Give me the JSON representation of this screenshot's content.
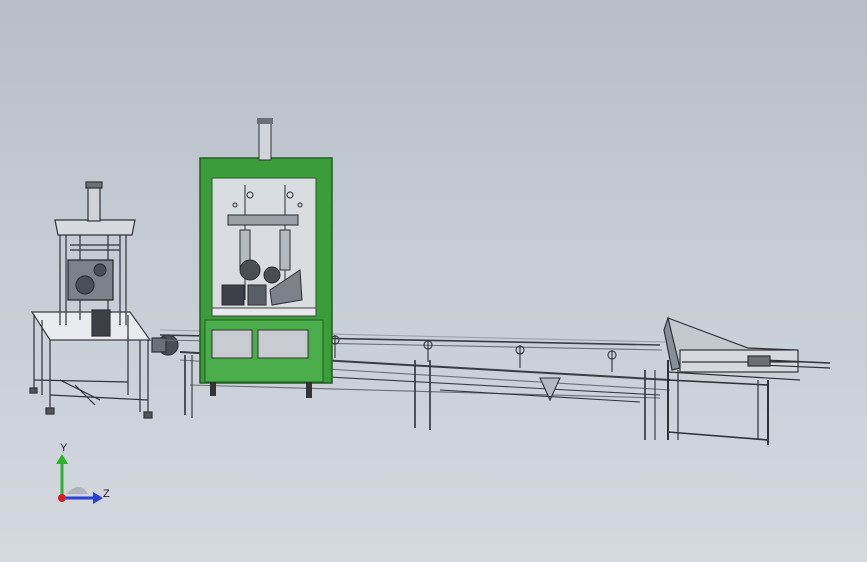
{
  "triad": {
    "y_label": "Y",
    "z_label": "Z",
    "colors": {
      "y_axis": "#2bb32b",
      "z_axis": "#2a3fd6",
      "x_axis": "#d42020"
    }
  },
  "scene": {
    "colors": {
      "background_top": "#b7bec9",
      "background_bottom": "#d4d8df",
      "cabinet_frame": "#3c9c3c",
      "cabinet_dark": "#1f5f1f",
      "frame_gray": "#8a8f97",
      "frame_dark": "#3a3d42",
      "panel_light": "#e8ebee"
    },
    "objects": [
      "left-assembly-station",
      "green-cabinet-press",
      "conveyor-rail",
      "discharge-chute"
    ]
  }
}
